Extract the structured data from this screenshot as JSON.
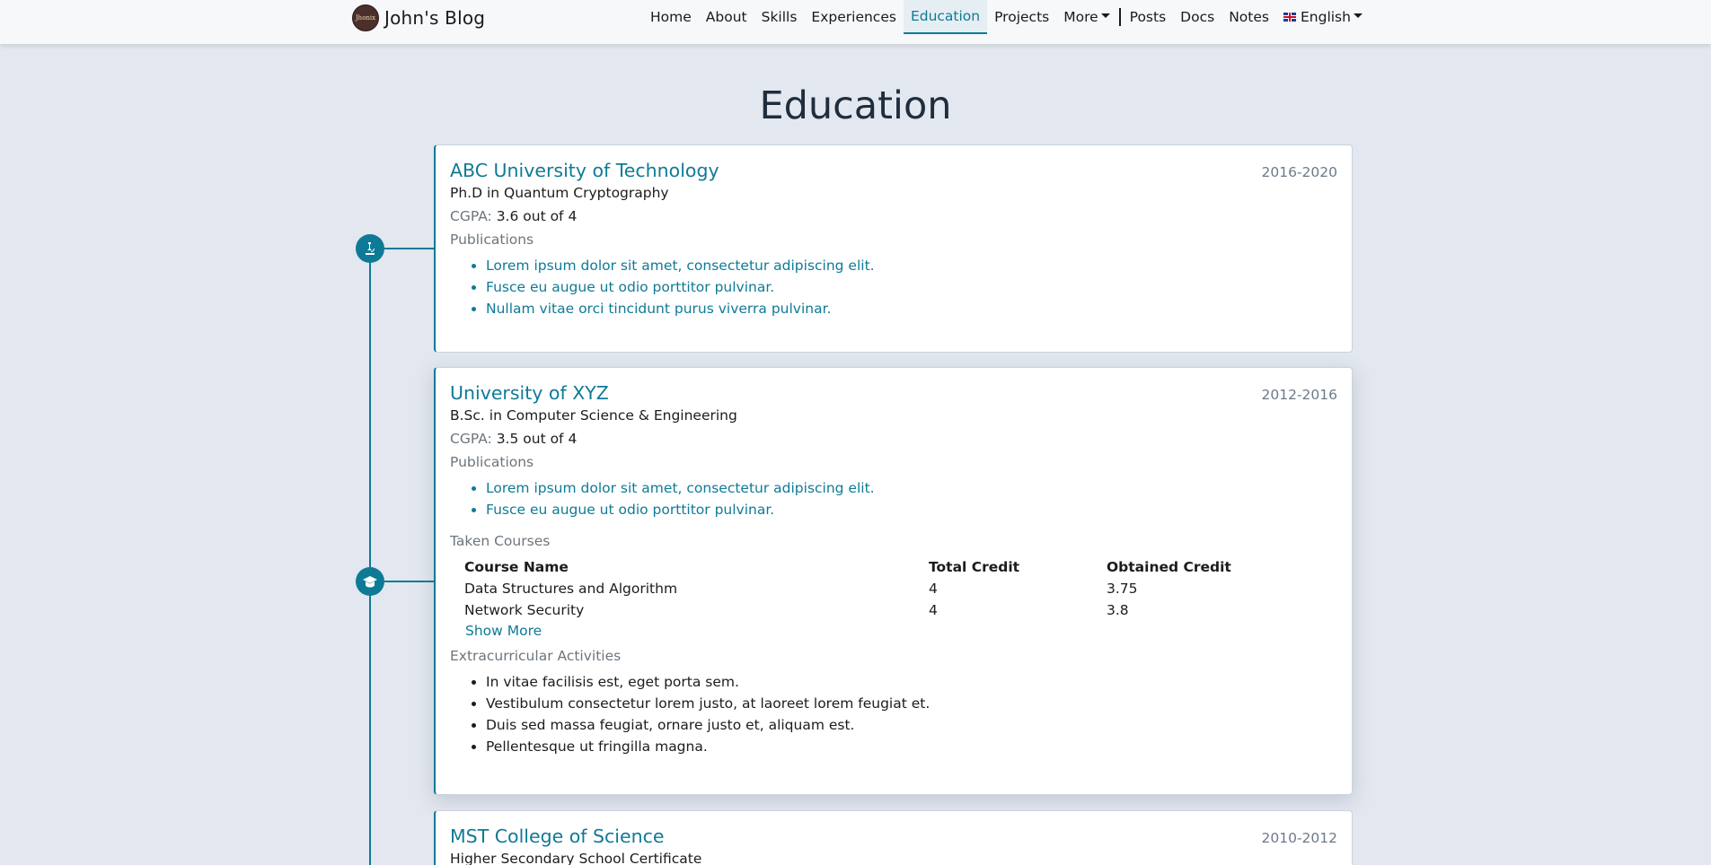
{
  "navbar": {
    "brand_name": "John's Blog",
    "brand_logo_text": "Jhonix",
    "items": [
      {
        "label": "Home"
      },
      {
        "label": "About"
      },
      {
        "label": "Skills"
      },
      {
        "label": "Experiences"
      },
      {
        "label": "Education",
        "active": true
      },
      {
        "label": "Projects"
      },
      {
        "label": "More",
        "dropdown": true
      },
      {
        "label": "Posts"
      },
      {
        "label": "Docs"
      },
      {
        "label": "Notes"
      }
    ],
    "language": {
      "label": "English",
      "flag": "uk-flag-icon"
    }
  },
  "page": {
    "title": "Education"
  },
  "colors": {
    "accent": "#0f7a96",
    "background": "#e3e7ef",
    "card": "#ffffff"
  },
  "education": [
    {
      "institution": "ABC University of Technology",
      "years": "2016-2020",
      "degree": "Ph.D in Quantum Cryptography",
      "cgpa_label": "CGPA:",
      "cgpa_value": "3.6 out of 4",
      "publications_label": "Publications",
      "publications": [
        "Lorem ipsum dolor sit amet, consectetur adipiscing elit.",
        "Fusce eu augue ut odio porttitor pulvinar.",
        "Nullam vitae orci tincidunt purus viverra pulvinar."
      ],
      "icon": "microscope-icon"
    },
    {
      "institution": "University of XYZ",
      "years": "2012-2016",
      "degree": "B.Sc. in Computer Science & Engineering",
      "cgpa_label": "CGPA:",
      "cgpa_value": "3.5 out of 4",
      "publications_label": "Publications",
      "publications": [
        "Lorem ipsum dolor sit amet, consectetur adipiscing elit.",
        "Fusce eu augue ut odio porttitor pulvinar."
      ],
      "courses_label": "Taken Courses",
      "courses_headers": [
        "Course Name",
        "Total Credit",
        "Obtained Credit"
      ],
      "courses": [
        [
          "Data Structures and Algorithm",
          "4",
          "3.75"
        ],
        [
          "Network Security",
          "4",
          "3.8"
        ]
      ],
      "show_more": "Show More",
      "extracurricular_label": "Extracurricular Activities",
      "extracurricular": [
        "In vitae facilisis est, eget porta sem.",
        "Vestibulum consectetur lorem justo, at laoreet lorem feugiat et.",
        "Duis sed massa feugiat, ornare justo et, aliquam est.",
        "Pellentesque ut fringilla magna."
      ],
      "icon": "graduation-cap-icon"
    },
    {
      "institution": "MST College of Science",
      "years": "2010-2012",
      "degree": "Higher Secondary School Certificate"
    }
  ]
}
